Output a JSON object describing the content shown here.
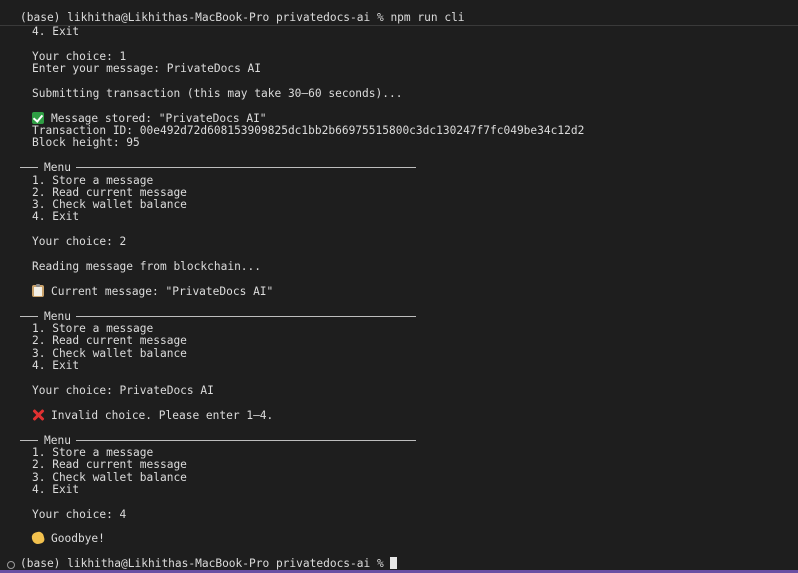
{
  "prompt": {
    "command_line": "(base) likhitha@Likhithas-MacBook-Pro privatedocs-ai % npm run cli",
    "final_prompt": "(base) likhitha@Likhithas-MacBook-Pro privatedocs-ai % "
  },
  "menu": {
    "title": "Menu",
    "items": [
      "1. Store a message",
      "2. Read current message",
      "3. Check wallet balance",
      "4. Exit"
    ]
  },
  "session1": {
    "exit_item": "4. Exit",
    "choice": "Your choice: 1",
    "message_prompt": "Enter your message: PrivateDocs AI",
    "submitting": "Submitting transaction (this may take 30–60 seconds)...",
    "stored": "Message stored: \"PrivateDocs AI\"",
    "transaction": "Transaction ID: 00e492d72d608153909825dc1bb2b66975515800c3dc130247f7fc049be34c12d2",
    "block_height": "Block height: 95"
  },
  "session2": {
    "choice": "Your choice: 2",
    "reading": "Reading message from blockchain...",
    "current": "Current message: \"PrivateDocs AI\""
  },
  "session3": {
    "choice": "Your choice: PrivateDocs AI",
    "invalid": "Invalid choice. Please enter 1–4."
  },
  "session4": {
    "choice": "Your choice: 4",
    "goodbye": "Goodbye!"
  },
  "icons": {
    "stored": "check-mark-icon",
    "current": "clipboard-icon",
    "invalid": "cross-mark-icon",
    "goodbye": "waving-hand-icon"
  }
}
